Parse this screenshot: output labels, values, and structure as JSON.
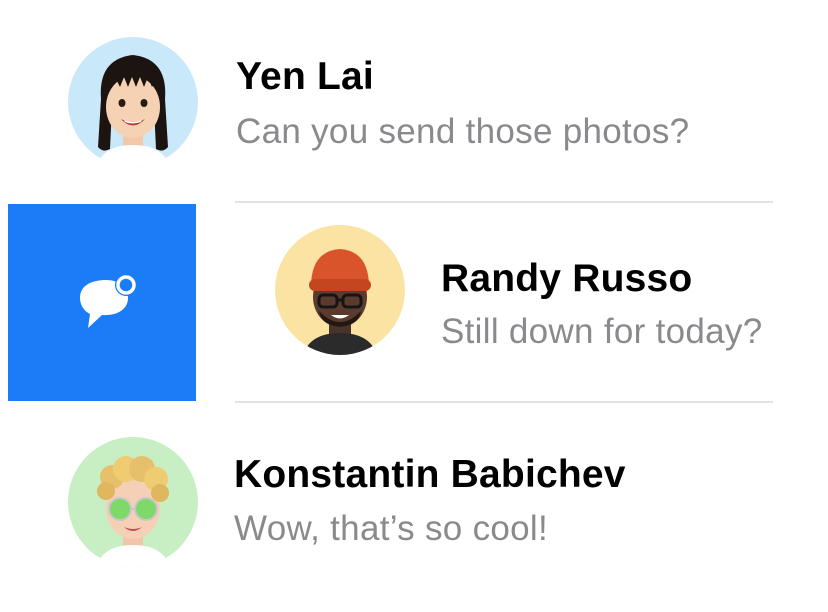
{
  "colors": {
    "unread_action_bg": "#1a7cf6",
    "preview_text": "#8a8a8e",
    "divider": "#e3e3e6",
    "avatar_bg": [
      "#c9e9fb",
      "#fbe3a4",
      "#c8efc4"
    ]
  },
  "swipe_action": {
    "icon": "unread-message-icon"
  },
  "conversations": [
    {
      "name": "Yen Lai",
      "preview": "Can you send those photos?",
      "avatar_icon": "memoji-avatar"
    },
    {
      "name": "Randy Russo",
      "preview": "Still down for today?",
      "avatar_icon": "memoji-avatar"
    },
    {
      "name": "Konstantin Babichev",
      "preview": "Wow, that’s so cool!",
      "avatar_icon": "memoji-avatar"
    }
  ]
}
